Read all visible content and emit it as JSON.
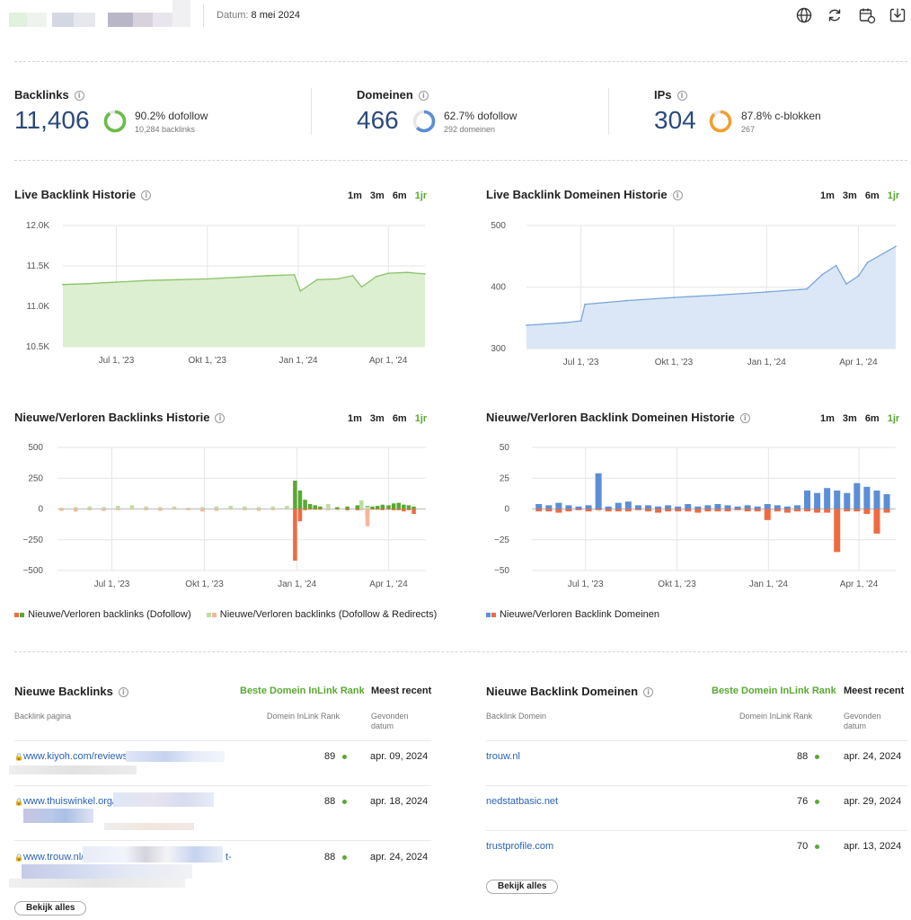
{
  "header": {
    "date_label": "Datum:",
    "date_value": "8 mei 2024",
    "icons": [
      "globe-icon",
      "refresh-icon",
      "schedule-icon",
      "download-icon"
    ]
  },
  "stats": [
    {
      "title": "Backlinks",
      "value": "11,406",
      "pct": "90.2% dofollow",
      "sub": "10,284 backlinks",
      "fraction": 0.902,
      "color": "#6cbb4a"
    },
    {
      "title": "Domeinen",
      "value": "466",
      "pct": "62.7% dofollow",
      "sub": "292 domeinen",
      "fraction": 0.627,
      "color": "#5b8ed6"
    },
    {
      "title": "IPs",
      "value": "304",
      "pct": "87.8% c-blokken",
      "sub": "267",
      "fraction": 0.878,
      "color": "#f0a030"
    }
  ],
  "periods": [
    "1m",
    "3m",
    "6m",
    "1jr"
  ],
  "active_period": "1jr",
  "x_ticks": [
    "Jul 1, '23",
    "Okt 1, '23",
    "Jan 1, '24",
    "Apr 1, '24"
  ],
  "charts": {
    "backlink_history": {
      "title": "Live Backlink Historie"
    },
    "domain_history": {
      "title": "Live Backlink Domeinen Historie"
    },
    "backlink_new_lost": {
      "title": "Nieuwe/Verloren Backlinks Historie"
    },
    "domain_new_lost": {
      "title": "Nieuwe/Verloren Backlink Domeinen Historie"
    }
  },
  "legends": {
    "backlinks_dofollow": "Nieuwe/Verloren backlinks (Dofollow)",
    "backlinks_redirects": "Nieuwe/Verloren backlinks (Dofollow & Redirects)",
    "domains": "Nieuwe/Verloren Backlink Domeinen"
  },
  "chart_data": [
    {
      "type": "area",
      "title": "Live Backlink Historie",
      "xlabel": "",
      "ylabel": "",
      "y_ticks": [
        "10.5K",
        "11.0K",
        "11.5K",
        "12.0K"
      ],
      "ylim": [
        10500,
        12000
      ],
      "x_range": [
        "2023-05-08",
        "2024-05-08"
      ],
      "x": [
        "2023-05-08",
        "2023-06-01",
        "2023-07-01",
        "2023-08-01",
        "2023-09-01",
        "2023-10-01",
        "2023-11-01",
        "2023-12-01",
        "2023-12-28",
        "2024-01-03",
        "2024-01-20",
        "2024-02-10",
        "2024-02-25",
        "2024-03-05",
        "2024-03-20",
        "2024-04-01",
        "2024-04-20",
        "2024-05-08"
      ],
      "values": [
        11270,
        11280,
        11300,
        11320,
        11330,
        11340,
        11360,
        11380,
        11390,
        11190,
        11330,
        11340,
        11380,
        11240,
        11370,
        11410,
        11420,
        11400
      ],
      "color": "#8cc36a",
      "fill": "#dcefd0"
    },
    {
      "type": "area",
      "title": "Live Backlink Domeinen Historie",
      "xlabel": "",
      "ylabel": "",
      "y_ticks": [
        "300",
        "400",
        "500"
      ],
      "ylim": [
        300,
        500
      ],
      "x_range": [
        "2023-05-08",
        "2024-05-08"
      ],
      "x": [
        "2023-05-08",
        "2023-06-15",
        "2023-07-01",
        "2023-07-05",
        "2023-08-15",
        "2023-10-01",
        "2023-11-15",
        "2024-01-01",
        "2024-02-10",
        "2024-02-25",
        "2024-03-10",
        "2024-03-20",
        "2024-04-01",
        "2024-04-10",
        "2024-05-08"
      ],
      "values": [
        338,
        342,
        345,
        372,
        378,
        383,
        387,
        392,
        397,
        420,
        435,
        405,
        418,
        440,
        466
      ],
      "color": "#7aa5dc",
      "fill": "#dbe7f6"
    },
    {
      "type": "bar",
      "title": "Nieuwe/Verloren Backlinks Historie",
      "xlabel": "",
      "ylabel": "",
      "y_ticks": [
        "500",
        "250",
        "0",
        "−250",
        "−500"
      ],
      "ylim": [
        -500,
        500
      ],
      "x_range": [
        "2023-05-08",
        "2024-05-08"
      ],
      "series": [
        {
          "name": "Nieuwe/Verloren backlinks (Dofollow)",
          "x": [
            "2023-12-30",
            "2024-01-04",
            "2024-01-09",
            "2024-01-14",
            "2024-01-19",
            "2024-01-24",
            "2024-02-10",
            "2024-02-20",
            "2024-03-01",
            "2024-03-11",
            "2024-03-16",
            "2024-03-21",
            "2024-03-26",
            "2024-04-01",
            "2024-04-06",
            "2024-04-11",
            "2024-04-16",
            "2024-04-21",
            "2024-04-26"
          ],
          "new": [
            230,
            150,
            75,
            40,
            30,
            20,
            15,
            20,
            30,
            25,
            20,
            25,
            35,
            30,
            45,
            50,
            35,
            30,
            20
          ],
          "lost": [
            -420,
            -100,
            -10,
            -5,
            -5,
            -5,
            -5,
            -10,
            -10,
            -55,
            -5,
            -5,
            -10,
            -5,
            -10,
            -10,
            -20,
            -10,
            -40
          ]
        },
        {
          "name": "Nieuwe/Verloren backlinks (Dofollow & Redirects)",
          "x": [
            "2023-05-12",
            "2023-05-26",
            "2023-06-09",
            "2023-06-23",
            "2023-07-07",
            "2023-07-21",
            "2023-08-04",
            "2023-08-18",
            "2023-09-01",
            "2023-09-15",
            "2023-09-29",
            "2023-10-13",
            "2023-10-27",
            "2023-11-10",
            "2023-11-24",
            "2023-12-08",
            "2023-12-22",
            "2024-02-01",
            "2024-03-05",
            "2024-03-11"
          ],
          "new": [
            10,
            15,
            20,
            15,
            25,
            30,
            20,
            15,
            20,
            10,
            15,
            20,
            25,
            20,
            15,
            20,
            25,
            40,
            70,
            20
          ],
          "lost": [
            -15,
            -20,
            -10,
            -15,
            -10,
            -5,
            -10,
            -15,
            -5,
            -10,
            -20,
            -15,
            -5,
            -10,
            -15,
            -10,
            -5,
            -10,
            -10,
            -140
          ]
        }
      ]
    },
    {
      "type": "bar",
      "title": "Nieuwe/Verloren Backlink Domeinen Historie",
      "xlabel": "",
      "ylabel": "",
      "y_ticks": [
        "50",
        "25",
        "0",
        "−25",
        "−50"
      ],
      "ylim": [
        -50,
        50
      ],
      "x_range": [
        "2023-05-08",
        "2024-05-08"
      ],
      "series": [
        {
          "name": "Nieuwe/Verloren Backlink Domeinen",
          "x": [
            "2023-05-15",
            "2023-05-25",
            "2023-06-04",
            "2023-06-14",
            "2023-06-24",
            "2023-07-04",
            "2023-07-14",
            "2023-07-24",
            "2023-08-03",
            "2023-08-13",
            "2023-08-23",
            "2023-09-02",
            "2023-09-12",
            "2023-09-22",
            "2023-10-02",
            "2023-10-12",
            "2023-10-22",
            "2023-11-01",
            "2023-11-11",
            "2023-11-21",
            "2023-12-01",
            "2023-12-11",
            "2023-12-21",
            "2023-12-31",
            "2024-01-10",
            "2024-01-20",
            "2024-01-30",
            "2024-02-09",
            "2024-02-19",
            "2024-02-29",
            "2024-03-10",
            "2024-03-20",
            "2024-03-30",
            "2024-04-09",
            "2024-04-19",
            "2024-04-29"
          ],
          "new": [
            4,
            3,
            5,
            3,
            2,
            3,
            29,
            2,
            5,
            6,
            3,
            3,
            2,
            3,
            2,
            4,
            2,
            3,
            4,
            3,
            2,
            3,
            2,
            4,
            3,
            2,
            3,
            15,
            13,
            17,
            15,
            13,
            21,
            18,
            15,
            12
          ],
          "lost": [
            -2,
            -2,
            -3,
            -2,
            -1,
            -2,
            -1,
            -2,
            -2,
            -2,
            -1,
            -2,
            -3,
            -2,
            -2,
            -2,
            -3,
            -2,
            -2,
            -2,
            -1,
            -2,
            -2,
            -9,
            -2,
            -3,
            -2,
            -2,
            -3,
            -3,
            -35,
            -2,
            -2,
            -4,
            -20,
            -3
          ]
        }
      ]
    }
  ],
  "tables": {
    "left": {
      "title": "Nieuwe Backlinks",
      "sort_best": "Beste Domein InLink Rank",
      "sort_recent": "Meest recent",
      "col_page": "Backlink pagina",
      "col_rank": "Domein InLink Rank",
      "col_date_1": "Gevonden",
      "col_date_2": "datum",
      "rows": [
        {
          "url": "www.kiyoh.com/reviews",
          "rank": "89",
          "date": "apr. 09, 2024"
        },
        {
          "url": "www.thuiswinkel.org/",
          "rank": "88",
          "date": "apr. 18, 2024"
        },
        {
          "url": "www.trouw.nl/",
          "url_tail": "t-",
          "rank": "88",
          "date": "apr. 24, 2024"
        }
      ],
      "button": "Bekijk alles"
    },
    "right": {
      "title": "Nieuwe Backlink Domeinen",
      "sort_best": "Beste Domein InLink Rank",
      "sort_recent": "Meest recent",
      "col_page": "Backlink Domein",
      "col_rank": "Domein InLink Rank",
      "col_date_1": "Gevonden",
      "col_date_2": "datum",
      "rows": [
        {
          "url": "trouw.nl",
          "rank": "88",
          "date": "apr. 24, 2024"
        },
        {
          "url": "nedstatbasic.net",
          "rank": "76",
          "date": "apr. 29, 2024"
        },
        {
          "url": "trustprofile.com",
          "rank": "70",
          "date": "apr. 13, 2024"
        }
      ],
      "button": "Bekijk alles"
    }
  },
  "colors": {
    "green": "#5aa832",
    "blue": "#5b8ed6",
    "red": "#f06a40",
    "pale_green": "#b9dea3",
    "pale_red": "#f6b49c",
    "link": "#2a62b8"
  }
}
